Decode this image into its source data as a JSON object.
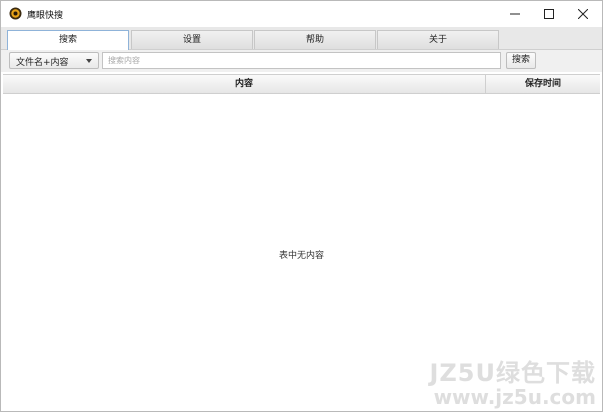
{
  "window": {
    "title": "鹰眼快搜",
    "controls": {
      "minimize": "—",
      "maximize": "☐",
      "close": "✕"
    }
  },
  "tabs": [
    {
      "label": "搜索",
      "active": true
    },
    {
      "label": "设置",
      "active": false
    },
    {
      "label": "帮助",
      "active": false
    },
    {
      "label": "关于",
      "active": false
    }
  ],
  "search": {
    "mode_selected": "文件名+内容",
    "placeholder": "搜索内容",
    "value": "",
    "button_label": "搜索"
  },
  "table": {
    "columns": [
      "内容",
      "保存时间"
    ],
    "empty_message": "表中无内容"
  },
  "watermark": {
    "line1": "JZ5U绿色下载",
    "line2": "www.jz5u.com"
  },
  "colors": {
    "active_tab_border": "#8fb3d9",
    "accent": "#e8a317"
  }
}
